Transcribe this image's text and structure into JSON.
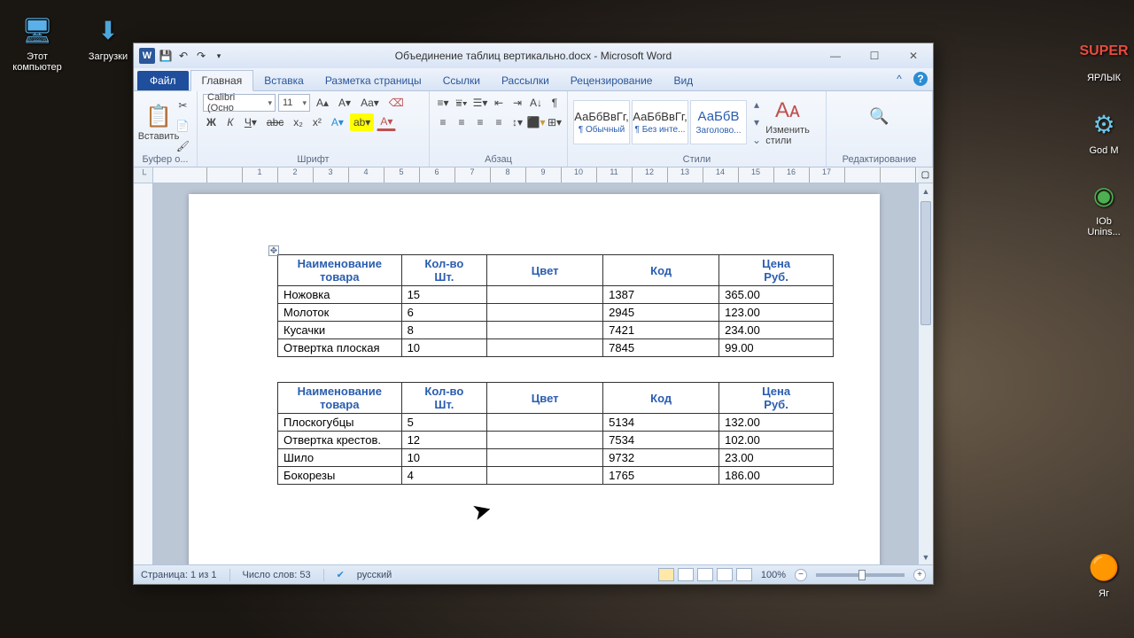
{
  "desktop": {
    "icons": [
      {
        "label": "Этот\nкомпьютер",
        "glyph": "🖥"
      },
      {
        "label": "Загрузки",
        "glyph": "📂"
      },
      {
        "label": "ЯРЛЫК",
        "glyph": "📄"
      },
      {
        "label": "God M",
        "glyph": "⚙"
      },
      {
        "label": "IOb\nUnins...",
        "glyph": "🟢"
      },
      {
        "label": "Яг",
        "glyph": "🟠"
      }
    ]
  },
  "window": {
    "title": "Объединение таблиц вертикально.docx - Microsoft Word",
    "tabs": {
      "file": "Файл",
      "home": "Главная",
      "insert": "Вставка",
      "layout": "Разметка страницы",
      "refs": "Ссылки",
      "mail": "Рассылки",
      "review": "Рецензирование",
      "view": "Вид"
    },
    "ribbon": {
      "clipboard": {
        "paste": "Вставить",
        "label": "Буфер о..."
      },
      "font": {
        "name": "Calibri (Осно",
        "size": "11",
        "label": "Шрифт"
      },
      "paragraph": {
        "label": "Абзац"
      },
      "styles": {
        "label": "Стили",
        "s1": {
          "sample": "АаБбВвГг,",
          "name": "¶ Обычный"
        },
        "s2": {
          "sample": "АаБбВвГг,",
          "name": "¶ Без инте..."
        },
        "s3": {
          "sample": "АаБбВ",
          "name": "Заголово..."
        },
        "change": "Изменить\nстили"
      },
      "editing": {
        "label": "Редактирование"
      }
    }
  },
  "tables": {
    "headers": [
      "Наименование\nтовара",
      "Кол-во\nШт.",
      "Цвет",
      "Код",
      "Цена\nРуб."
    ],
    "t1": [
      [
        "Ножовка",
        "15",
        "",
        "1387",
        "365.00"
      ],
      [
        "Молоток",
        "6",
        "",
        "2945",
        "123.00"
      ],
      [
        "Кусачки",
        "8",
        "",
        "7421",
        "234.00"
      ],
      [
        "Отвертка плоская",
        "10",
        "",
        "7845",
        "99.00"
      ]
    ],
    "t2": [
      [
        "Плоскогубцы",
        "5",
        "",
        "5134",
        "132.00"
      ],
      [
        "Отвертка крестов.",
        "12",
        "",
        "7534",
        "102.00"
      ],
      [
        "Шило",
        "10",
        "",
        "9732",
        "23.00"
      ],
      [
        "Бокорезы",
        "4",
        "",
        "1765",
        "186.00"
      ]
    ]
  },
  "status": {
    "page": "Страница: 1 из 1",
    "words": "Число слов: 53",
    "lang": "русский",
    "zoom": "100%"
  }
}
